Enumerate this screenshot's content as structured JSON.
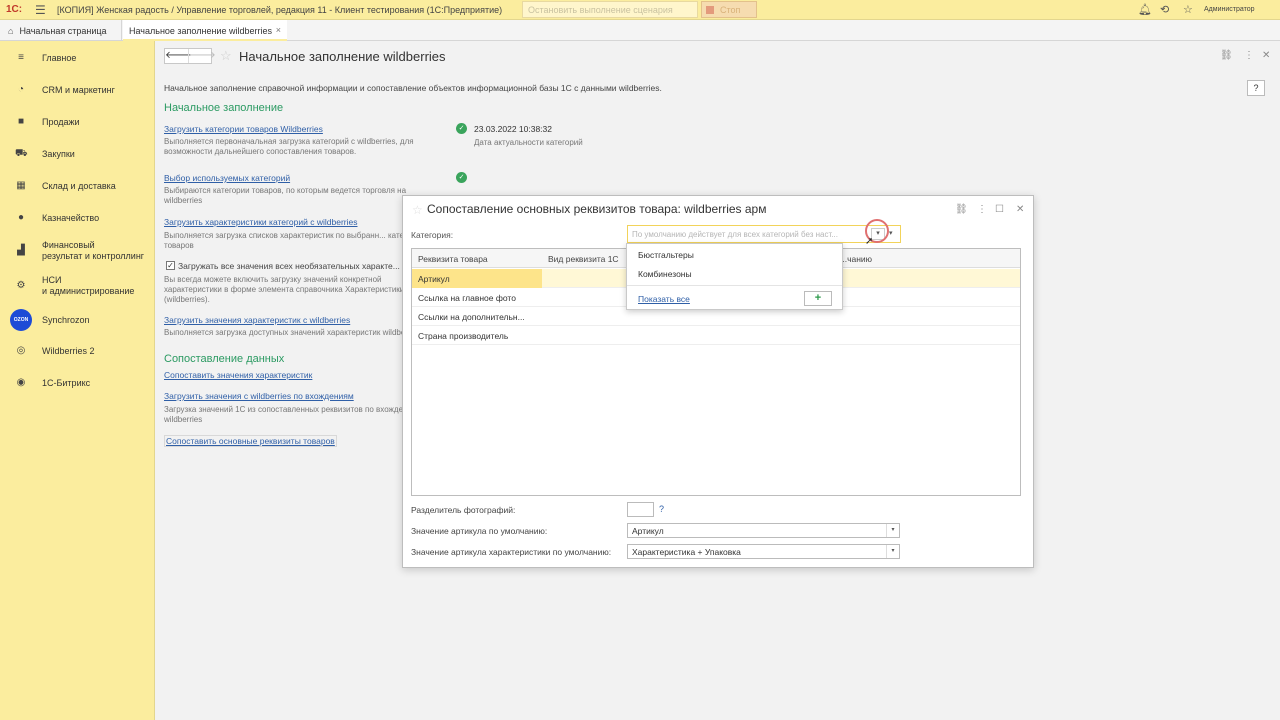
{
  "topbar": {
    "logo": "1С:",
    "title": "[КОПИЯ] Женская радость / Управление торговлей, редакция 11  - Клиент тестирования (1С:Предприятие)",
    "scenario_placeholder": "Остановить выполнение сценария",
    "stop_label": "Стоп",
    "user": "Администратор"
  },
  "tabs": {
    "home": "Начальная страница",
    "active": "Начальное заполнение wildberries"
  },
  "sidebar": {
    "items": [
      {
        "label": "Главное"
      },
      {
        "label": "CRM и маркетинг"
      },
      {
        "label": "Продажи"
      },
      {
        "label": "Закупки"
      },
      {
        "label": "Склад и доставка"
      },
      {
        "label": "Казначейство"
      },
      {
        "label": "Финансовый\nрезультат и контроллинг"
      },
      {
        "label": "НСИ\nи администрирование"
      },
      {
        "label": "Synchrozon"
      },
      {
        "label": "Wildberries 2"
      },
      {
        "label": "1С-Битрикс"
      }
    ],
    "ozon_badge": "OZON"
  },
  "form": {
    "title": "Начальное заполнение wildberries",
    "help": "?",
    "description": "Начальное заполнение справочной информации и сопоставление объектов информационной базы 1С с данными wildberries.",
    "section1": "Начальное заполнение",
    "load_categories_link": "Загрузить категории товаров Wildberries",
    "load_categories_note": "Выполняется первоначальная загрузка категорий с wildberries, для возможности дальнейшего сопоставления товаров.",
    "categories_date": "23.03.2022 10:38:32",
    "categories_date_note": "Дата актуальности категорий",
    "choose_categories_link": "Выбор используемых категорий",
    "choose_categories_note": "Выбираются категории товаров, по которым ведется торговля на wildberries",
    "load_chars_link": "Загрузить характеристики категорий с wildberries",
    "load_chars_note": "Выполняется загрузка списков характеристик по выбранн... категориям товаров",
    "load_all_checkbox": "Загружать все значения всех необязательных характе...",
    "load_all_note": "Вы всегда можете включить загрузку значений конкретной характеристики в форме элемента справочника Характеристики (wildberries).",
    "load_values_link": "Загрузить значения характеристик с wildberries",
    "load_values_note": "Выполняется загрузка доступных значений характеристик wildberries",
    "section2": "Сопоставление данных",
    "match_values_link": "Сопоставить значения характеристик",
    "load_by_entry_link": "Загрузить значения с wildberries по вхождениям",
    "load_by_entry_note": "Загрузка значений 1С из сопоставленных реквизитов по вхождениям в wildberries",
    "match_main_link": "Сопоставить основные реквизиты товаров"
  },
  "dialog": {
    "title": "Сопоставление основных реквизитов товара: wildberries арм",
    "category_label": "Категория:",
    "category_placeholder": "По умолчанию действует для всех категорий без наст...",
    "columns": [
      "Реквизита товара",
      "Вид реквизита 1С",
      "...чанию"
    ],
    "rows": [
      "Артикул",
      "Ссылка на главное фото",
      "Ссылки на дополнительн...",
      "Страна производитель"
    ],
    "photo_sep_label": "Разделитель фотографий:",
    "photo_sep_help": "?",
    "article_default_label": "Значение артикула по умолчанию:",
    "article_default_value": "Артикул",
    "char_article_default_label": "Значение артикула характеристики по умолчанию:",
    "char_article_default_value": "Характеристика + Упаковка"
  },
  "dropdown": {
    "items": [
      "Бюстгальтеры",
      "Комбинезоны"
    ],
    "show_all": "Показать все",
    "add": "+"
  }
}
